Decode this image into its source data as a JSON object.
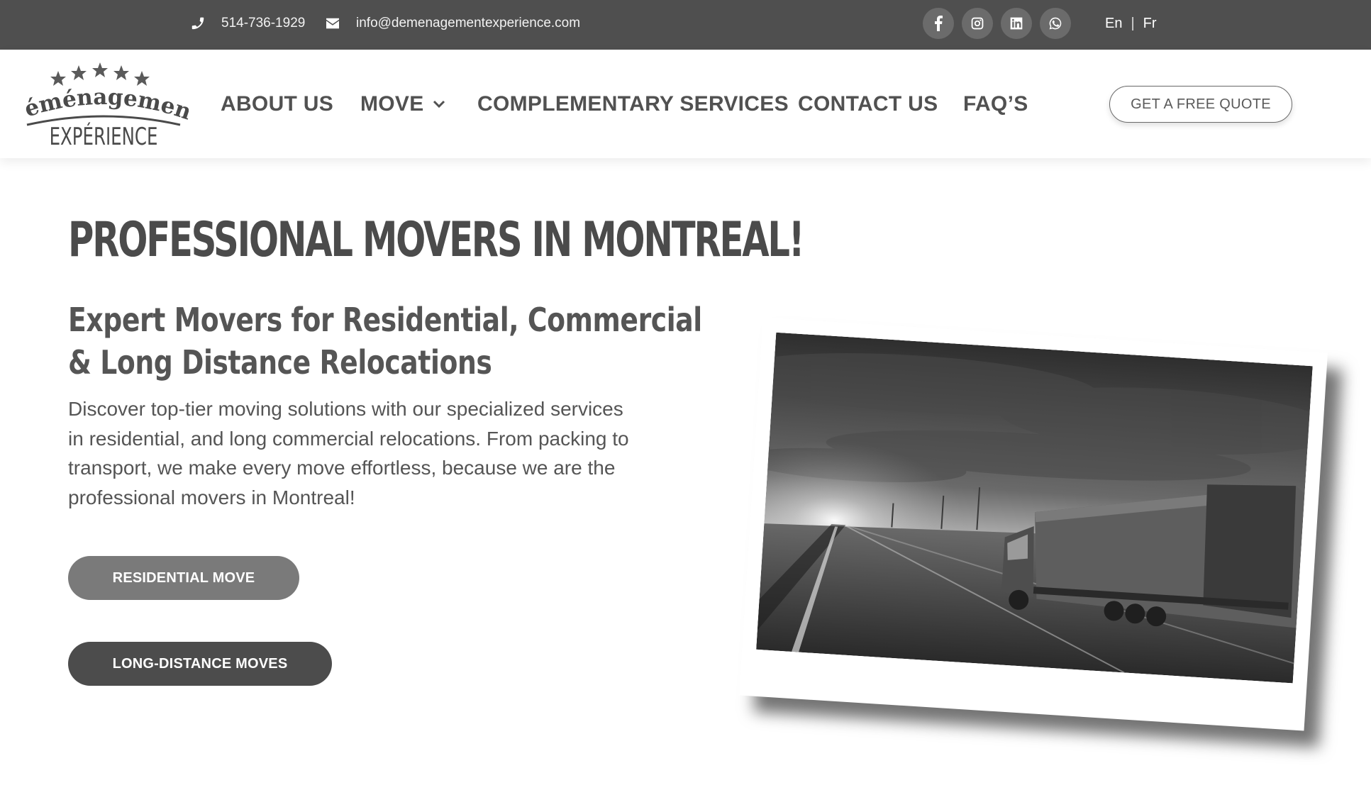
{
  "topbar": {
    "phone": "514-736-1929",
    "email": "info@demenagementexperience.com",
    "social_icons": [
      "facebook-icon",
      "instagram-icon",
      "linkedin-icon",
      "whatsapp-icon"
    ],
    "lang_en": "En",
    "lang_sep": "|",
    "lang_fr": "Fr"
  },
  "logo": {
    "line1": "Déménagement",
    "line2": "EXPÉRIENCE"
  },
  "nav": {
    "about": "ABOUT US",
    "move": "MOVE",
    "complementary": "COMPLEMENTARY SERVICES",
    "contact": "CONTACT US",
    "faq": "FAQ’S",
    "quote": "GET A FREE QUOTE"
  },
  "hero": {
    "title": "PROFESSIONAL MOVERS IN MONTREAL!",
    "subtitle_line1": "Expert Movers for Residential, Commercial",
    "subtitle_line2": "& Long Distance Relocations",
    "description": "Discover top-tier moving solutions with our specialized services in residential, and long commercial relocations. From packing to transport, we make every move effortless, because we are the professional movers in Montreal!",
    "btn_residential": "RESIDENTIAL MOVE",
    "btn_long": "LONG-DISTANCE MOVES"
  },
  "colors": {
    "topbar_bg": "#4f4f4f",
    "social_bg": "#6b6b6b",
    "btn_residential": "#7a7a7a",
    "btn_long": "#4c4c4c",
    "text": "#4b4b4b"
  }
}
